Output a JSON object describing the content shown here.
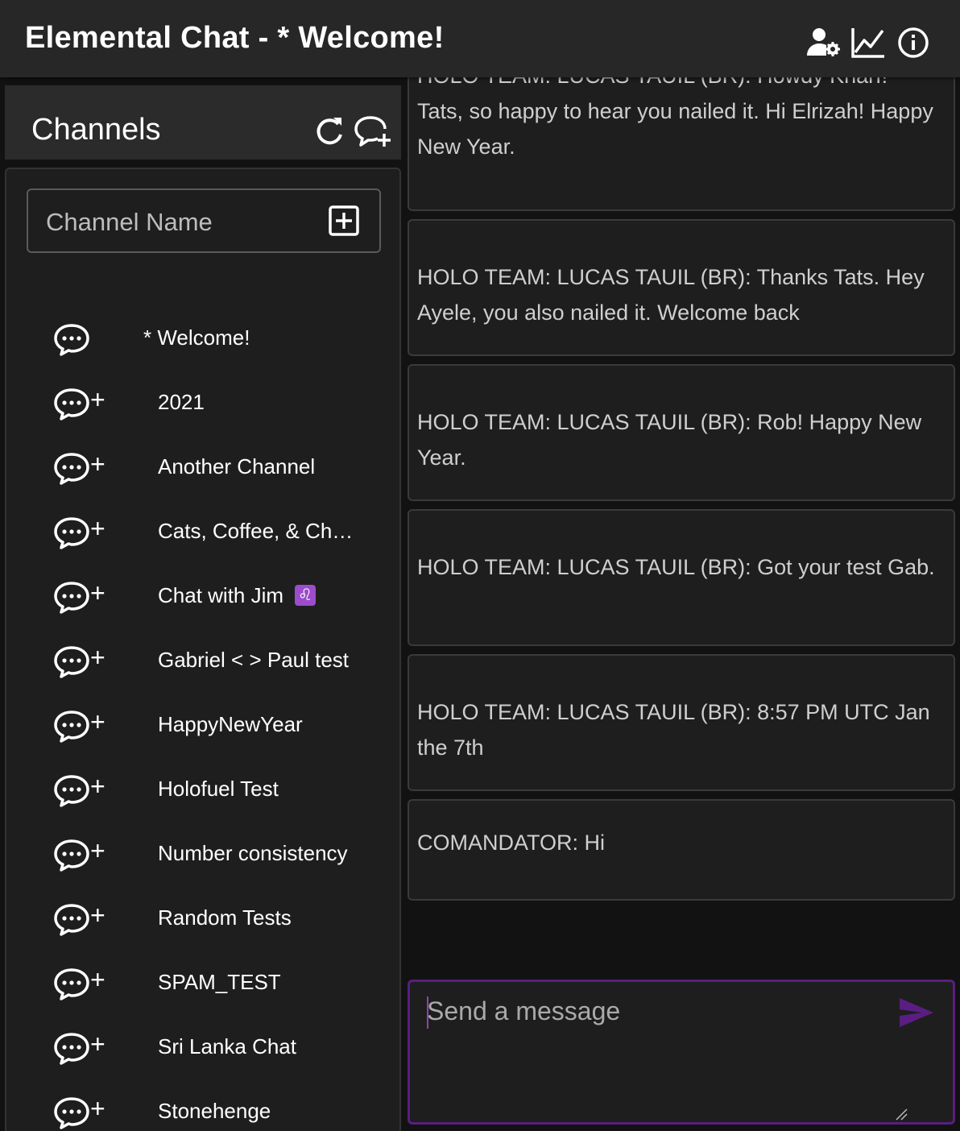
{
  "app": {
    "title": "Elemental Chat - * Welcome!",
    "icons": [
      "user-settings-icon",
      "chart-line-icon",
      "info-icon"
    ],
    "accent_color": "#5a1e82"
  },
  "sidebar": {
    "title": "Channels",
    "header_icons": [
      "refresh-icon",
      "new-chat-icon"
    ],
    "channel_input": {
      "placeholder": "Channel Name",
      "add_icon": "plus-box-icon"
    },
    "channels": [
      {
        "label": "* Welcome!",
        "active": true
      },
      {
        "label": "2021",
        "active": false
      },
      {
        "label": "Another Channel",
        "active": false
      },
      {
        "label": "Cats, Coffee, & Chocolate",
        "active": false
      },
      {
        "label": "Chat with Jim",
        "emoji": "♌",
        "active": false
      },
      {
        "label": "Gabriel < > Paul test",
        "active": false
      },
      {
        "label": "HappyNewYear",
        "active": false
      },
      {
        "label": "Holofuel Test",
        "active": false
      },
      {
        "label": "Number consistency",
        "active": false
      },
      {
        "label": "Random Tests",
        "active": false
      },
      {
        "label": "SPAM_TEST",
        "active": false
      },
      {
        "label": "Sri Lanka Chat",
        "active": false
      },
      {
        "label": "Stonehenge",
        "active": false
      }
    ]
  },
  "messages": [
    {
      "text": "HOLO TEAM: LUCAS TAUIL (BR): Howdy Knarf! Tats, so happy to hear you nailed it. Hi Elrizah! Happy New Year."
    },
    {
      "text": "HOLO TEAM: LUCAS TAUIL (BR): Thanks Tats. Hey Ayele, you also nailed it. Welcome back"
    },
    {
      "text": "HOLO TEAM: LUCAS TAUIL (BR): Rob! Happy New Year."
    },
    {
      "text": "HOLO TEAM: LUCAS TAUIL (BR): Got your test Gab."
    },
    {
      "text": "HOLO TEAM: LUCAS TAUIL (BR): 8:57 PM UTC Jan the 7th"
    },
    {
      "text": "COMANDATOR: Hi"
    }
  ],
  "composer": {
    "placeholder": "Send a message",
    "send_icon": "send-icon"
  }
}
